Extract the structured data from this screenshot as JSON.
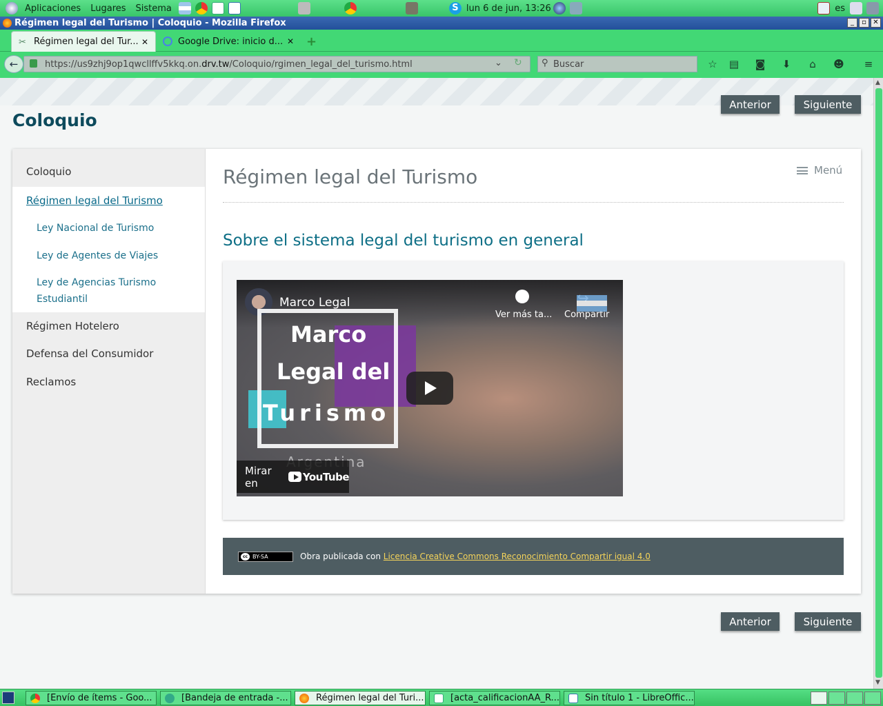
{
  "panel": {
    "menus": [
      "Aplicaciones",
      "Lugares",
      "Sistema"
    ],
    "clock": "lun  6 de jun, 13:26",
    "keyboard": "es"
  },
  "window": {
    "title": "Régimen legal del Turismo | Coloquio - Mozilla Firefox"
  },
  "tabs": [
    {
      "label": "Régimen legal del Tur..."
    },
    {
      "label": "Google Drive: inicio d..."
    }
  ],
  "navbar": {
    "url_prefix": "https://us9zhj9op1qwcllffv5kkq.on.",
    "url_domain": "drv.tw",
    "url_path": "/Coloquio/rgimen_legal_del_turismo.html",
    "search_placeholder": "Buscar"
  },
  "page": {
    "site_title": "Coloquio",
    "prev_label": "Anterior",
    "next_label": "Siguiente",
    "main_title": "Régimen legal del Turismo",
    "menu_label": "Menú",
    "subheading": "Sobre el sistema legal del turismo en general",
    "sidebar": {
      "top": "Coloquio",
      "active": "Régimen legal del Turismo",
      "sub1": "Ley Nacional de Turismo",
      "sub2": "Ley de Agentes de Viajes",
      "sub3a": "Ley de Agencias Turismo",
      "sub3b": "Estudiantil",
      "item4": "Régimen Hotelero",
      "item5": "Defensa del Consumidor",
      "item6": "Reclamos"
    },
    "video": {
      "channel": "Marco Legal",
      "watch_later": "Ver más ta...",
      "share": "Compartir",
      "overlay_line1": "Marco",
      "overlay_line2": "Legal del",
      "overlay_line3": "Turismo",
      "overlay_line4": "Argentina",
      "watch_on": "Mirar en",
      "yt_brand": "YouTube"
    },
    "license": {
      "badge": "BY-SA",
      "text": "Obra publicada con",
      "link": "Licencia Creative Commons Reconocimiento Compartir igual 4.0"
    }
  },
  "taskbar": [
    "[Envío de ítems - Goo...",
    "[Bandeja de entrada -...",
    "Régimen legal del Turi...",
    "[acta_calificacionAA_R...",
    "Sin título 1 - LibreOffic..."
  ]
}
